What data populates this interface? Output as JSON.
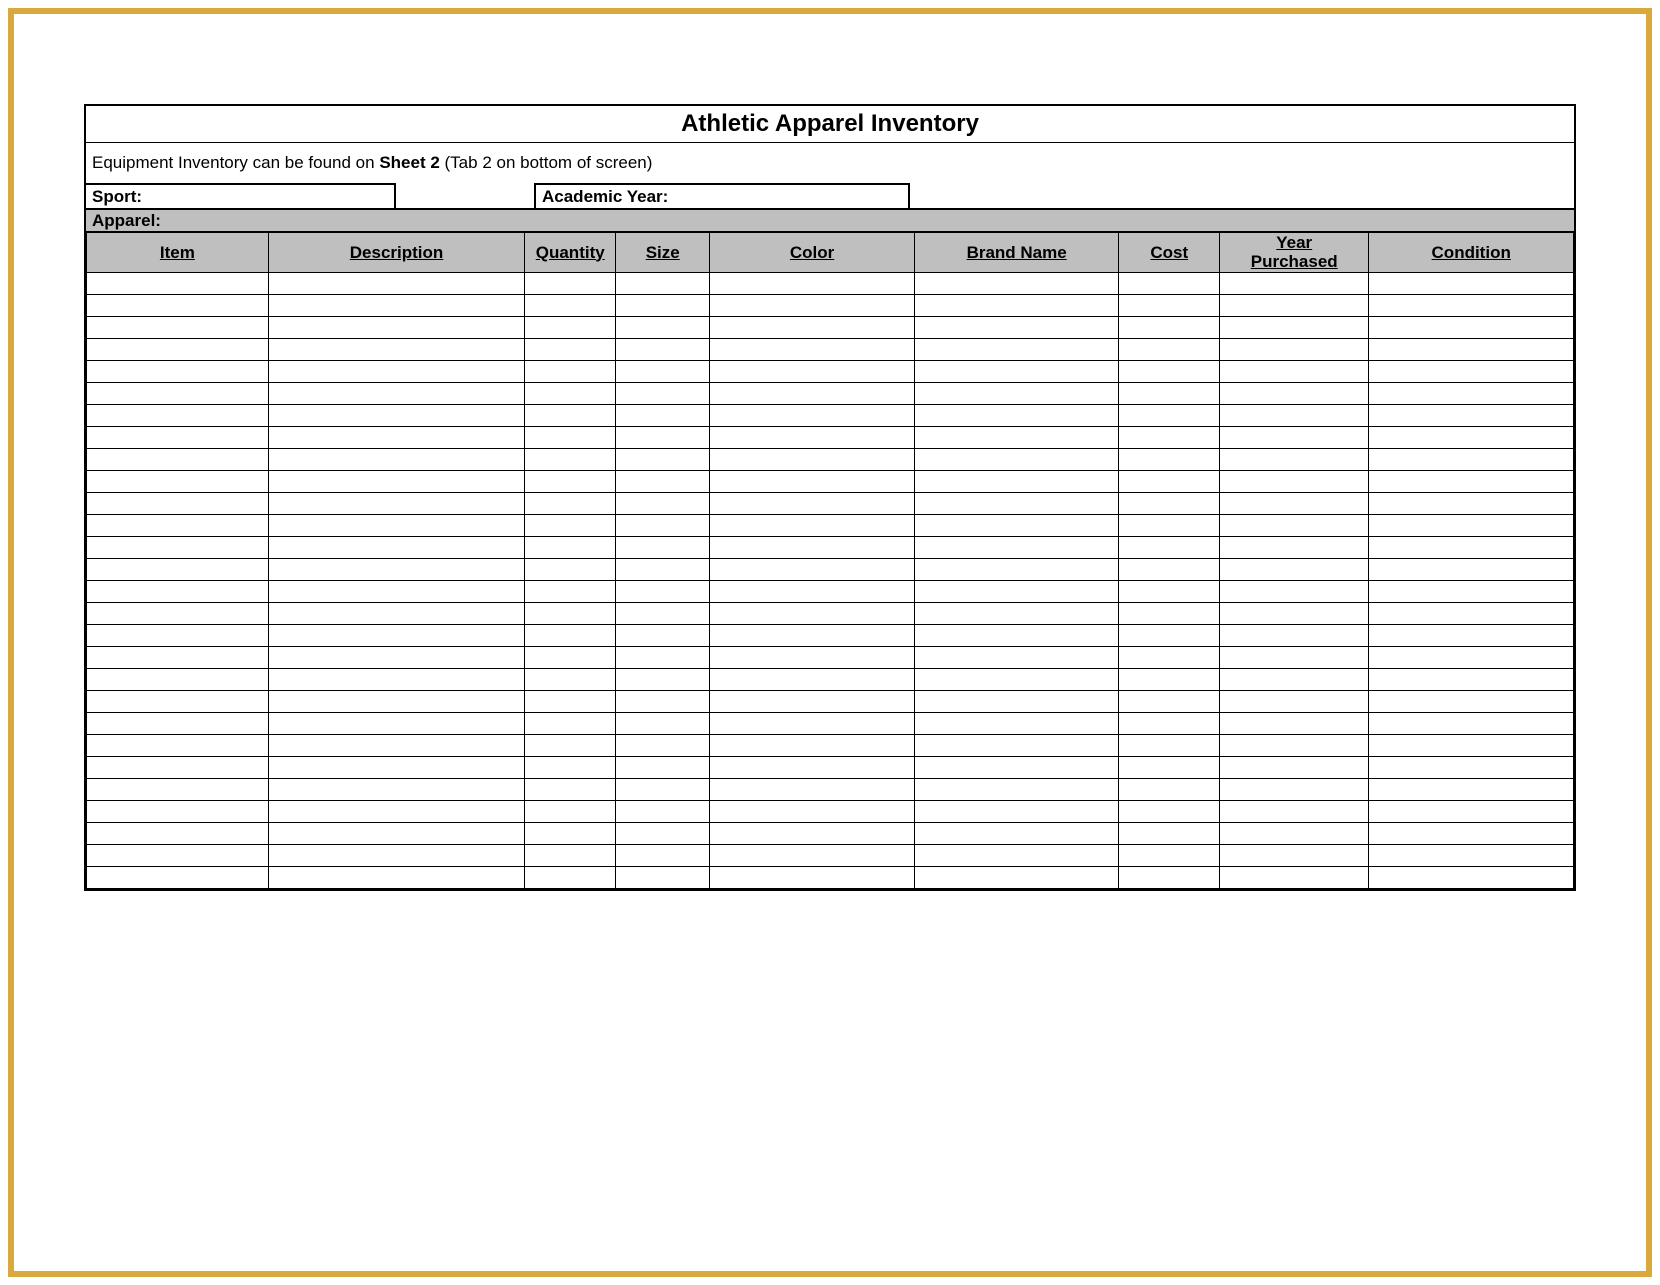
{
  "title": "Athletic Apparel Inventory",
  "note_prefix": "Equipment Inventory can be found on ",
  "note_bold": "Sheet 2",
  "note_suffix": " (Tab 2 on bottom of screen)",
  "info": {
    "sport_label": "Sport:",
    "academic_year_label": "Academic Year:"
  },
  "section_label": "Apparel:",
  "columns": {
    "item": "Item",
    "description": "Description",
    "quantity": "Quantity",
    "size": "Size",
    "color": "Color",
    "brand": "Brand Name",
    "cost": "Cost",
    "year_purchased_line1": "Year",
    "year_purchased_line2": "Purchased",
    "condition": "Condition"
  },
  "row_count": 28,
  "rows": [],
  "colors": {
    "frame_border": "#d9a93e",
    "header_fill": "#bfbfbf",
    "line": "#000000"
  }
}
